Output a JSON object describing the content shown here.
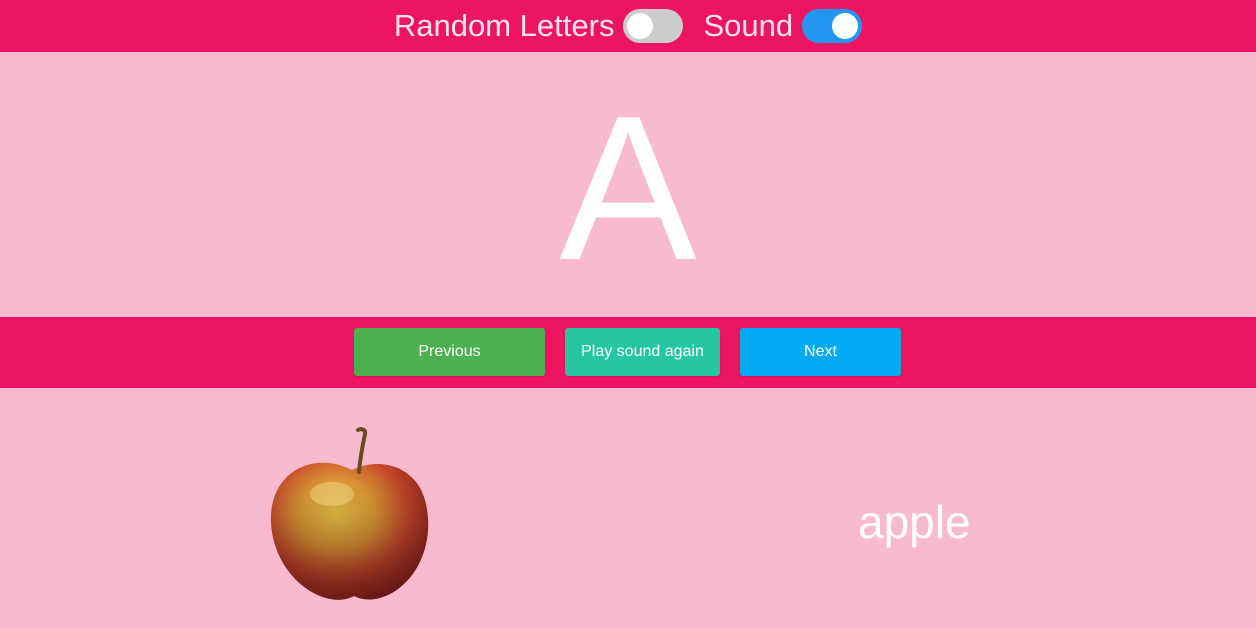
{
  "header": {
    "random_letters_label": "Random Letters",
    "random_letters_on": false,
    "sound_label": "Sound",
    "sound_on": true
  },
  "card": {
    "letter": "A",
    "word": "apple",
    "picture_icon": "apple-icon"
  },
  "controls": {
    "previous_label": "Previous",
    "play_label": "Play sound again",
    "next_label": "Next"
  },
  "colors": {
    "header_bar": "#ed1563",
    "panel_bg": "#f9b9cf",
    "previous_button": "#4caf50",
    "play_button": "#26c6a5",
    "next_button": "#03a9f4",
    "toggle_on": "#2196f3",
    "toggle_off": "#cccccc"
  }
}
